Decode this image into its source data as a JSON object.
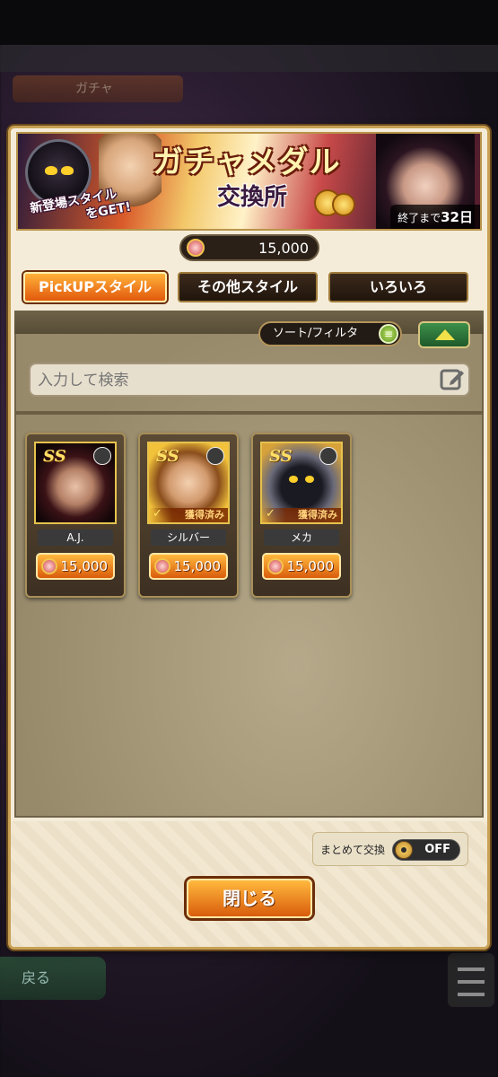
{
  "background": {
    "screen_title": "ガチャ",
    "back_label": "戻る"
  },
  "banner": {
    "title": "ガチャメダル",
    "subtitle": "交換所",
    "promo_line1": "新登場スタイル",
    "promo_line2": "をGET!",
    "deadline_prefix": "終了まで",
    "deadline_value": "32日"
  },
  "medal_balance": "15,000",
  "tabs": [
    {
      "label": "PickUPスタイル",
      "active": true
    },
    {
      "label": "その他スタイル",
      "active": false
    },
    {
      "label": "いろいろ",
      "active": false
    }
  ],
  "sort_filter": {
    "label": "ソート/フィルタ",
    "icon": "list-icon"
  },
  "collapse_toggle": {
    "icon": "triangle-up-icon"
  },
  "search": {
    "placeholder": "入力して検索",
    "value": "",
    "icon": "edit-icon"
  },
  "items": [
    {
      "name": "A.J.",
      "rank": "SS",
      "owned": false,
      "owned_label": "",
      "price": "15,000",
      "weapon_icon": "weapon-icon",
      "portrait_colors": [
        "#2a1410",
        "#d9a98a",
        "#7a1c1c"
      ]
    },
    {
      "name": "シルバー",
      "rank": "SS",
      "owned": true,
      "owned_label": "獲得済み",
      "price": "15,000",
      "weapon_icon": "sword-icon",
      "portrait_colors": [
        "#f2c23a",
        "#e8b48a",
        "#8a4e1c"
      ]
    },
    {
      "name": "メカ",
      "rank": "SS",
      "owned": true,
      "owned_label": "獲得済み",
      "price": "15,000",
      "weapon_icon": "gun-icon",
      "portrait_colors": [
        "#d7a23a",
        "#1a1a22",
        "#6a6a7a"
      ]
    }
  ],
  "bulk_exchange": {
    "label": "まとめて交換",
    "state": "OFF"
  },
  "close_button": {
    "label": "閉じる"
  },
  "colors": {
    "accent_orange": "#e2590d",
    "panel_cream": "#f4ecd8",
    "frame_gold": "#c8a154"
  }
}
